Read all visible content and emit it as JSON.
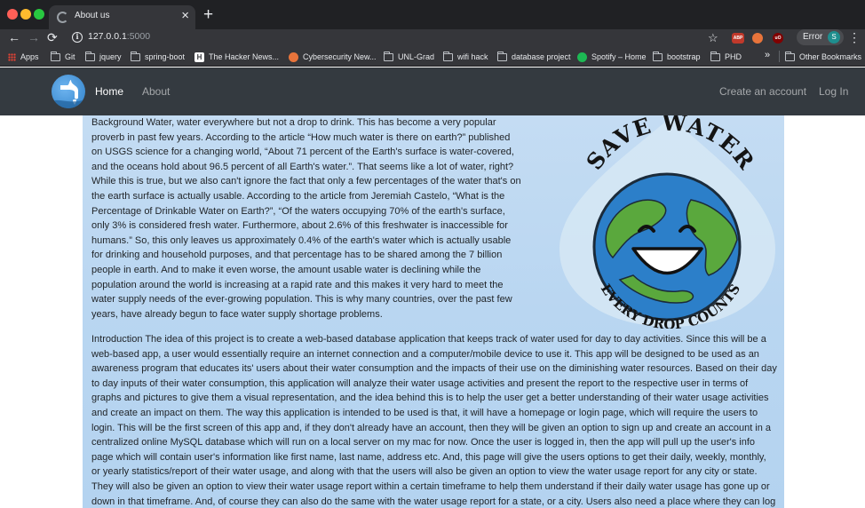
{
  "browser": {
    "tab_title": "About us",
    "new_tab": "+",
    "close": "×",
    "url_host": "127.0.0.1",
    "url_port": ":5000",
    "error_label": "Error",
    "profile_initial": "S",
    "extensions": [
      "ABP",
      "uO"
    ],
    "bookmarks": [
      {
        "label": "Apps",
        "icon": "apps-icon"
      },
      {
        "label": "Git",
        "icon": "folder-icon"
      },
      {
        "label": "jquery",
        "icon": "folder-icon"
      },
      {
        "label": "spring-boot",
        "icon": "folder-icon"
      },
      {
        "label": "The Hacker News...",
        "icon": "hacker-news-icon"
      },
      {
        "label": "Cybersecurity New...",
        "icon": "cybersecurity-icon"
      },
      {
        "label": "UNL-Grad",
        "icon": "folder-icon"
      },
      {
        "label": "wifi hack",
        "icon": "folder-icon"
      },
      {
        "label": "database project",
        "icon": "folder-icon"
      },
      {
        "label": "Spotify – Home",
        "icon": "spotify-icon"
      },
      {
        "label": "bootstrap",
        "icon": "folder-icon"
      },
      {
        "label": "PHD",
        "icon": "folder-icon"
      }
    ],
    "overflow": "»",
    "other_bookmarks": "Other Bookmarks"
  },
  "nav": {
    "home": "Home",
    "about": "About",
    "create_account": "Create an account",
    "login": "Log In"
  },
  "content": {
    "background_text": "Background Water, water everywhere but not a drop to drink. This has become a very popular proverb in past few years. According to the article “How much water is there on earth?” published on USGS science for a changing world, “About 71 percent of the Earth's surface is water-covered, and the oceans hold about 96.5 percent of all Earth's water.”. That seems like a lot of water, right? While this is true, but we also can't ignore the fact that only a few percentages of the water that's on the earth surface is actually usable. According to the article from Jeremiah Castelo, “What is the Percentage of Drinkable Water on Earth?”, “Of the waters occupying 70% of the earth's surface, only 3% is considered fresh water. Furthermore, about 2.6% of this freshwater is inaccessible for humans.” So, this only leaves us approximately 0.4% of the earth's water which is actually usable for drinking and household purposes, and that percentage has to be shared among the 7 billion people in earth. And to make it even worse, the amount usable water is declining while the population around the world is increasing at a rapid rate and this makes it very hard to meet the water supply needs of the ever-growing population. This is why many countries, over the past few years, have already begun to face water supply shortage problems.",
    "introduction_text": "Introduction The idea of this project is to create a web-based database application that keeps track of water used for day to day activities. Since this will be a web-based app, a user would essentially require an internet connection and a computer/mobile device to use it. This app will be designed to be used as an awareness program that educates its' users about their water consumption and the impacts of their use on the diminishing water resources. Based on their day to day inputs of their water consumption, this application will analyze their water usage activities and present the report to the respective user in terms of graphs and pictures to give them a visual representation, and the idea behind this is to help the user get a better understanding of their water usage activities and create an impact on them. The way this application is intended to be used is that, it will have a homepage or login page, which will require the users to login. This will be the first screen of this app and, if they don't already have an account, then they will be given an option to sign up and create an account in a centralized online MySQL database which will run on a local server on my mac for now. Once the user is logged in, then the app will pull up the user's info page which will contain user's information like first name, last name, address etc. And, this page will give the users options to get their daily, weekly, monthly, or yearly statistics/report of their water usage, and along with that the users will also be given an option to view the water usage report for any city or state. They will also be given an option to view their water usage report within a certain timeframe to help them understand if their daily water usage has gone up or down in that timeframe. And, of course they can also do the same with the water usage report for a state, or a city. Users also need a place where they can log in their daily water usage activities like shower, kitchen,",
    "art_top_text": "SAVE WATER",
    "art_bottom_text": "EVERY DROP COUNTS"
  },
  "colors": {
    "navbar": "#343a40",
    "content_bg": "#bcd8f2",
    "chrome_dark": "#202124",
    "chrome_mid": "#35363a"
  }
}
